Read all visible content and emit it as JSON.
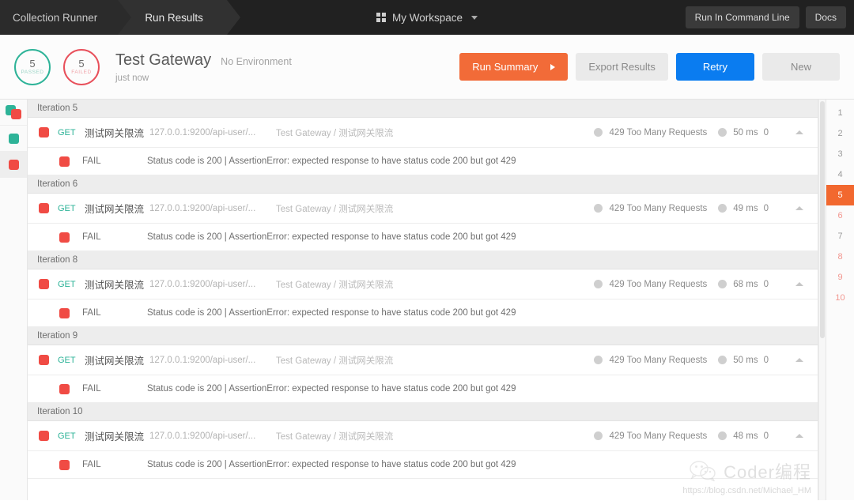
{
  "header": {
    "breadcrumb_primary": "Collection Runner",
    "breadcrumb_secondary": "Run Results",
    "workspace_label": "My Workspace",
    "run_in_command_line_label": "Run In Command Line",
    "docs_label": "Docs",
    "workspace_icon": "grid-icon",
    "workspace_caret_icon": "chevron-down-icon"
  },
  "summary": {
    "passed_count": "5",
    "passed_label": "PASSED",
    "failed_count": "5",
    "failed_label": "FAILED",
    "run_title": "Test Gateway",
    "environment": "No Environment",
    "timestamp": "just now",
    "run_summary_label": "Run Summary",
    "export_results_label": "Export Results",
    "retry_label": "Retry",
    "new_label": "New",
    "colors": {
      "passed": "#2eb398",
      "failed": "#e8505b",
      "run_summary": "#f26b38",
      "retry": "#0a7cf0"
    }
  },
  "filter_rail": {
    "items": [
      {
        "name": "filter-all",
        "icon": "all-results-icon",
        "active": false
      },
      {
        "name": "filter-passed",
        "icon": "passed-square-icon",
        "active": false
      },
      {
        "name": "filter-failed",
        "icon": "failed-square-icon",
        "active": true
      }
    ]
  },
  "results": {
    "iterations": [
      {
        "header": "Iteration 5",
        "request": {
          "method": "GET",
          "name": "测试网关限流",
          "url": "127.0.0.1:9200/api-user/...",
          "folder": "Test Gateway / 测试网关限流",
          "status": "429 Too Many Requests",
          "time": "50 ms",
          "size": "0",
          "result": "fail",
          "collapse_icon": "chevron-up-icon"
        },
        "assertion": {
          "label": "FAIL",
          "text": "Status code is 200 | AssertionError: expected response to have status code 200 but got 429"
        }
      },
      {
        "header": "Iteration 6",
        "request": {
          "method": "GET",
          "name": "测试网关限流",
          "url": "127.0.0.1:9200/api-user/...",
          "folder": "Test Gateway / 测试网关限流",
          "status": "429 Too Many Requests",
          "time": "49 ms",
          "size": "0",
          "result": "fail",
          "collapse_icon": "chevron-up-icon"
        },
        "assertion": {
          "label": "FAIL",
          "text": "Status code is 200 | AssertionError: expected response to have status code 200 but got 429"
        }
      },
      {
        "header": "Iteration 8",
        "request": {
          "method": "GET",
          "name": "测试网关限流",
          "url": "127.0.0.1:9200/api-user/...",
          "folder": "Test Gateway / 测试网关限流",
          "status": "429 Too Many Requests",
          "time": "68 ms",
          "size": "0",
          "result": "fail",
          "collapse_icon": "chevron-up-icon"
        },
        "assertion": {
          "label": "FAIL",
          "text": "Status code is 200 | AssertionError: expected response to have status code 200 but got 429"
        }
      },
      {
        "header": "Iteration 9",
        "request": {
          "method": "GET",
          "name": "测试网关限流",
          "url": "127.0.0.1:9200/api-user/...",
          "folder": "Test Gateway / 测试网关限流",
          "status": "429 Too Many Requests",
          "time": "50 ms",
          "size": "0",
          "result": "fail",
          "collapse_icon": "chevron-up-icon"
        },
        "assertion": {
          "label": "FAIL",
          "text": "Status code is 200 | AssertionError: expected response to have status code 200 but got 429"
        }
      },
      {
        "header": "Iteration 10",
        "request": {
          "method": "GET",
          "name": "测试网关限流",
          "url": "127.0.0.1:9200/api-user/...",
          "folder": "Test Gateway / 测试网关限流",
          "status": "429 Too Many Requests",
          "time": "48 ms",
          "size": "0",
          "result": "fail",
          "collapse_icon": "chevron-up-icon"
        },
        "assertion": {
          "label": "FAIL",
          "text": "Status code is 200 | AssertionError: expected response to have status code 200 but got 429"
        }
      }
    ]
  },
  "iteration_index": {
    "items": [
      {
        "label": "1",
        "state": "normal"
      },
      {
        "label": "2",
        "state": "normal"
      },
      {
        "label": "3",
        "state": "normal"
      },
      {
        "label": "4",
        "state": "normal"
      },
      {
        "label": "5",
        "state": "active"
      },
      {
        "label": "6",
        "state": "failed"
      },
      {
        "label": "7",
        "state": "normal"
      },
      {
        "label": "8",
        "state": "failed"
      },
      {
        "label": "9",
        "state": "failed"
      },
      {
        "label": "10",
        "state": "failed"
      }
    ]
  },
  "watermark": {
    "logo_icon": "wechat-icon",
    "text": "Coder编程",
    "url": "https://blog.csdn.net/Michael_HM"
  }
}
